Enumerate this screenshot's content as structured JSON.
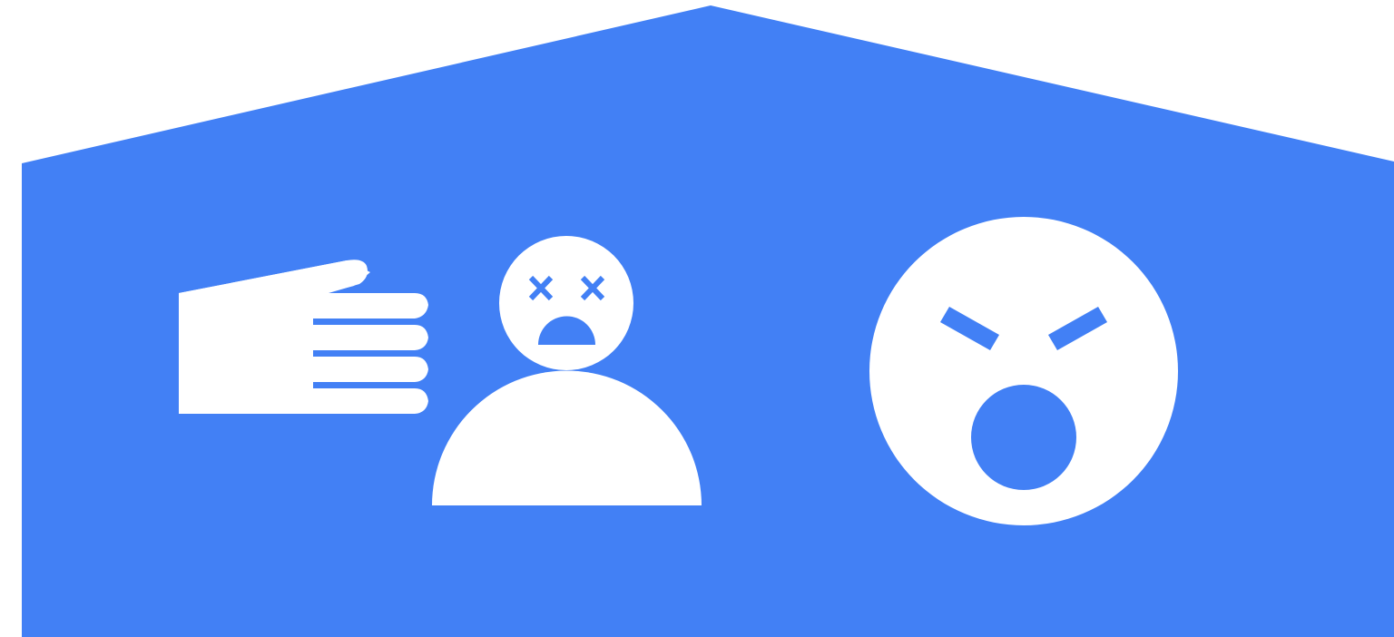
{
  "colors": {
    "background": "#ffffff",
    "house": "#4280f5",
    "figure": "#ffffff"
  },
  "icons": {
    "house": "house-shape-icon",
    "hand": "slapping-hand-icon",
    "victim": "dizzy-person-icon",
    "angry_face": "shouting-angry-face-icon"
  }
}
